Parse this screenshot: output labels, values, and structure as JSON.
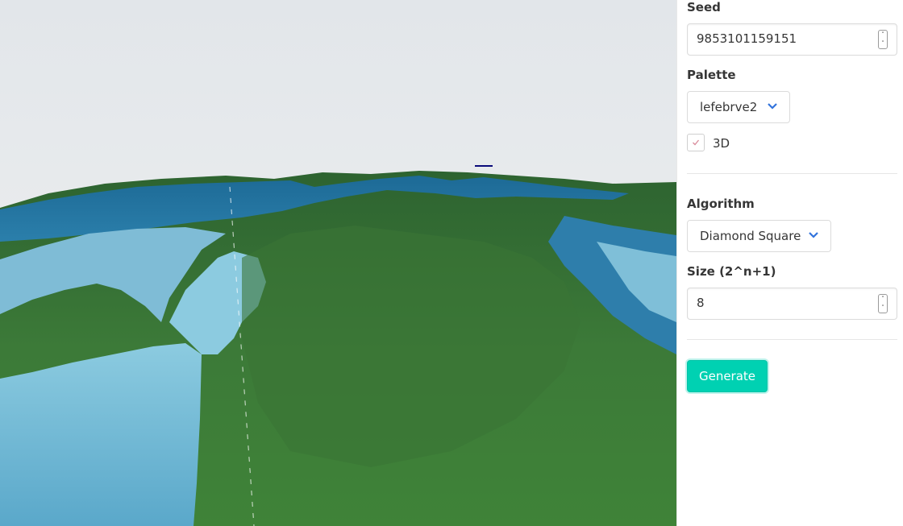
{
  "controls": {
    "seed": {
      "label": "Seed",
      "value": "9853101159151"
    },
    "palette": {
      "label": "Palette",
      "selected": "lefebrve2"
    },
    "three_d": {
      "label": "3D",
      "checked": true
    },
    "algorithm": {
      "label": "Algorithm",
      "selected": "Diamond Square"
    },
    "size": {
      "label": "Size (2^n+1)",
      "value": "8"
    },
    "generate_label": "Generate"
  },
  "scene": {
    "sky_top": "#e2e6ea",
    "sky_bottom": "#f0f1f1",
    "land_color": "#3f7a3a",
    "land_dark": "#2c5f2e",
    "water_deep": "#1a5e8a",
    "water_light": "#8ccbe0"
  },
  "colors": {
    "accent": "#00d1b2",
    "chevron": "#3273dc"
  }
}
